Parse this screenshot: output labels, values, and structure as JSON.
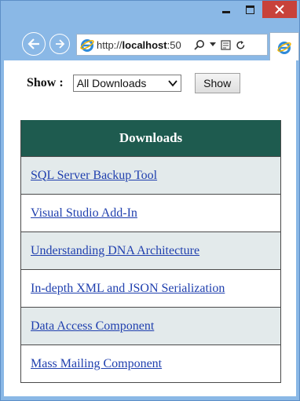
{
  "browser": {
    "url_prefix": "http://",
    "url_host": "localhost",
    "url_rest": ":50",
    "search_glyph": "⌕",
    "dropdown_glyph": "▾",
    "refresh_glyph": "↻"
  },
  "filter": {
    "label": "Show :",
    "selected": "All Downloads",
    "button_label": "Show"
  },
  "downloads": {
    "header": "Downloads",
    "items": [
      "SQL Server Backup Tool",
      "Visual Studio Add-In",
      "Understanding DNA Architecture",
      "In-depth XML and JSON Serialization",
      "Data Access Component",
      "Mass Mailing Component"
    ]
  },
  "colors": {
    "header_bg": "#1e5b4f",
    "row_shade": "#e3eaeb",
    "link": "#1f3fae",
    "close_button": "#c8423a",
    "window_frame": "#8ab8e6"
  },
  "icons": [
    "minimize-icon",
    "maximize-icon",
    "close-icon",
    "back-arrow-icon",
    "forward-arrow-icon",
    "ie-logo-icon",
    "search-icon",
    "compat-view-icon",
    "refresh-icon",
    "chevron-down-icon"
  ]
}
